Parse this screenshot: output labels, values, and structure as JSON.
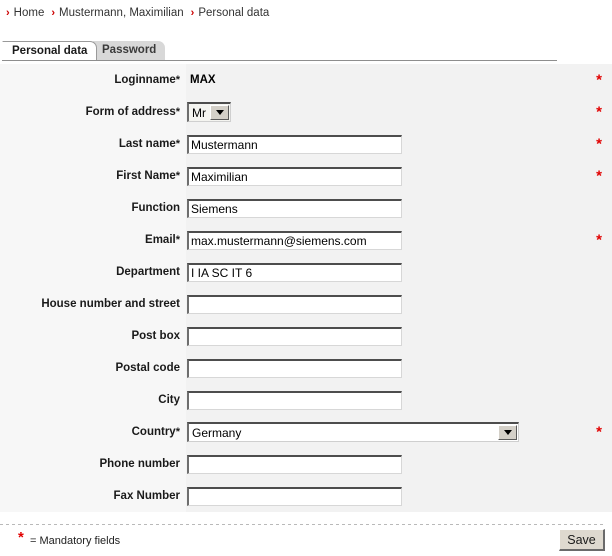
{
  "breadcrumb": {
    "separator": "›",
    "items": [
      "Home",
      "Mustermann, Maximilian",
      "Personal data"
    ]
  },
  "tabs": [
    {
      "label": "Personal data",
      "active": true
    },
    {
      "label": "Password",
      "active": false
    }
  ],
  "form": {
    "required_marker": "*",
    "rows": [
      {
        "label": "Loginname",
        "required": true,
        "type": "static",
        "value": "MAX"
      },
      {
        "label": "Form of address",
        "required": true,
        "type": "select-small",
        "value": "Mr"
      },
      {
        "label": "Last name",
        "required": true,
        "type": "text",
        "value": "Mustermann"
      },
      {
        "label": "First Name",
        "required": true,
        "type": "text",
        "value": "Maximilian"
      },
      {
        "label": "Function",
        "required": false,
        "type": "text",
        "value": "Siemens"
      },
      {
        "label": "Email",
        "required": true,
        "type": "text",
        "value": "max.mustermann@siemens.com"
      },
      {
        "label": "Department",
        "required": false,
        "type": "text",
        "value": "I IA SC IT 6"
      },
      {
        "label": "House number and street",
        "required": false,
        "type": "text",
        "value": ""
      },
      {
        "label": "Post box",
        "required": false,
        "type": "text",
        "value": ""
      },
      {
        "label": "Postal code",
        "required": false,
        "type": "text",
        "value": ""
      },
      {
        "label": "City",
        "required": false,
        "type": "text",
        "value": ""
      },
      {
        "label": "Country",
        "required": true,
        "type": "select-wide",
        "value": "Germany"
      },
      {
        "label": "Phone number",
        "required": false,
        "type": "text",
        "value": ""
      },
      {
        "label": "Fax Number",
        "required": false,
        "type": "text",
        "value": ""
      }
    ]
  },
  "footer": {
    "star": "*",
    "note": "= Mandatory fields",
    "save_label": "Save"
  },
  "colors": {
    "required": "#e10000",
    "breadcrumb_sep": "#cc0000",
    "label_bg": "#f7f7f7",
    "control_bg": "#f2f2f2"
  }
}
